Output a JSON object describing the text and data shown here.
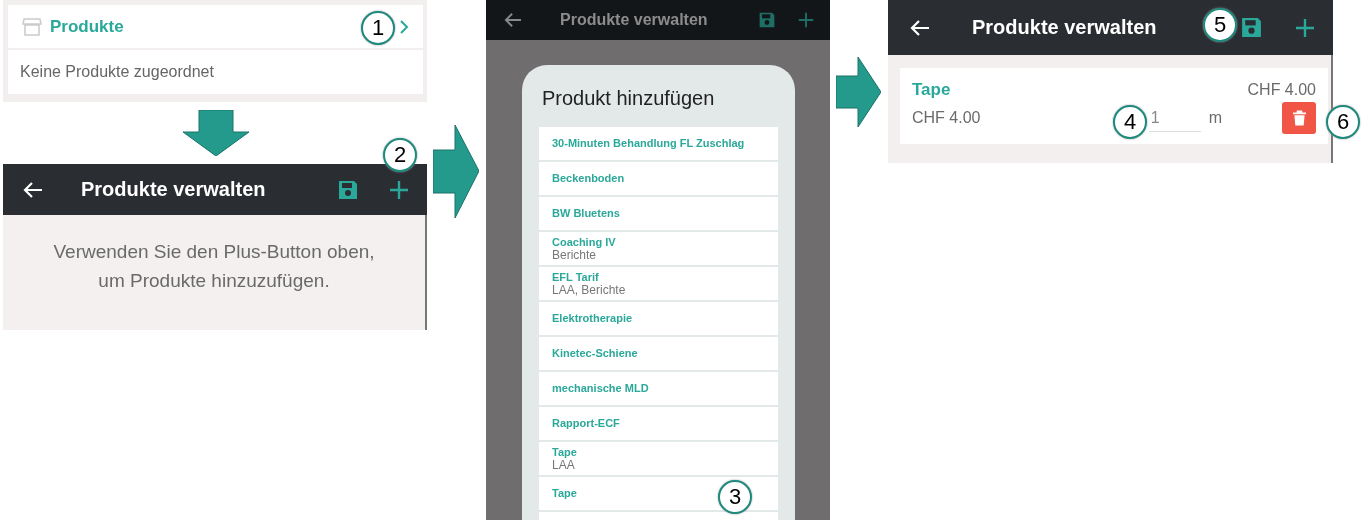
{
  "step1": {
    "section_title": "Produkte",
    "empty_text": "Keine Produkte zugeordnet"
  },
  "step2": {
    "title": "Produkte verwalten",
    "hint": "Verwenden Sie den Plus-Button oben,\num Produkte hinzuzufügen."
  },
  "step3": {
    "title": "Produkte verwalten",
    "dialog_title": "Produkt hinzufügen",
    "products": [
      {
        "name": "30-Minuten Behandlung FL Zuschlag"
      },
      {
        "name": "Beckenboden"
      },
      {
        "name": "BW Bluetens"
      },
      {
        "name": "Coaching IV",
        "detail": "Berichte"
      },
      {
        "name": "EFL Tarif",
        "detail": "LAA, Berichte"
      },
      {
        "name": "Elektrotherapie"
      },
      {
        "name": "Kinetec-Schiene"
      },
      {
        "name": "mechanische MLD"
      },
      {
        "name": "Rapport-ECF"
      },
      {
        "name": "Tape",
        "detail": "LAA"
      },
      {
        "name": "Tape"
      }
    ]
  },
  "step4": {
    "title": "Produkte verwalten",
    "items": [
      {
        "name": "Tape",
        "total": "CHF 4.00",
        "price": "CHF 4.00",
        "quantity": "1",
        "unit": "m"
      }
    ]
  },
  "callouts": [
    "1",
    "2",
    "3",
    "4",
    "5",
    "6"
  ]
}
